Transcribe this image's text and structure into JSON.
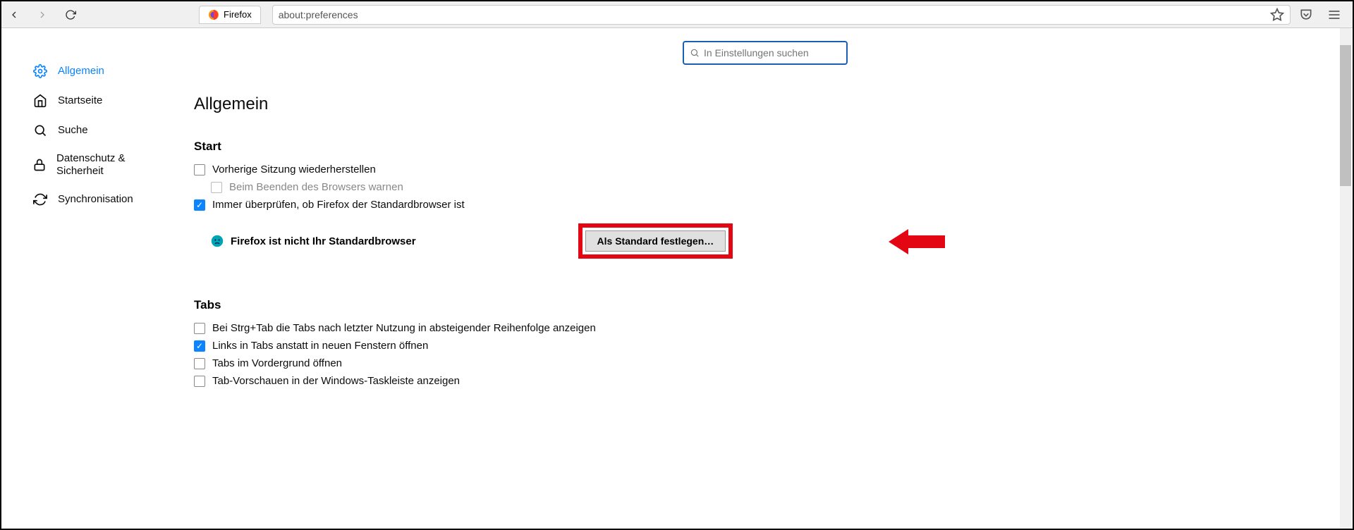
{
  "toolbar": {
    "tab_label": "Firefox",
    "url": "about:preferences"
  },
  "search": {
    "placeholder": "In Einstellungen suchen"
  },
  "sidebar": {
    "items": [
      {
        "label": "Allgemein"
      },
      {
        "label": "Startseite"
      },
      {
        "label": "Suche"
      },
      {
        "label": "Datenschutz & Sicherheit"
      },
      {
        "label": "Synchronisation"
      }
    ]
  },
  "content": {
    "title": "Allgemein",
    "start": {
      "heading": "Start",
      "restore_session": "Vorherige Sitzung wiederherstellen",
      "warn_on_quit": "Beim Beenden des Browsers warnen",
      "always_check": "Immer überprüfen, ob Firefox der Standardbrowser ist",
      "not_default_msg": "Firefox ist nicht Ihr Standardbrowser",
      "set_default_btn": "Als Standard festlegen…"
    },
    "tabs": {
      "heading": "Tabs",
      "ctrl_tab": "Bei Strg+Tab die Tabs nach letzter Nutzung in absteigender Reihenfolge anzeigen",
      "links_in_tabs": "Links in Tabs anstatt in neuen Fenstern öffnen",
      "foreground": "Tabs im Vordergrund öffnen",
      "taskbar_preview": "Tab-Vorschauen in der Windows-Taskleiste anzeigen"
    }
  }
}
